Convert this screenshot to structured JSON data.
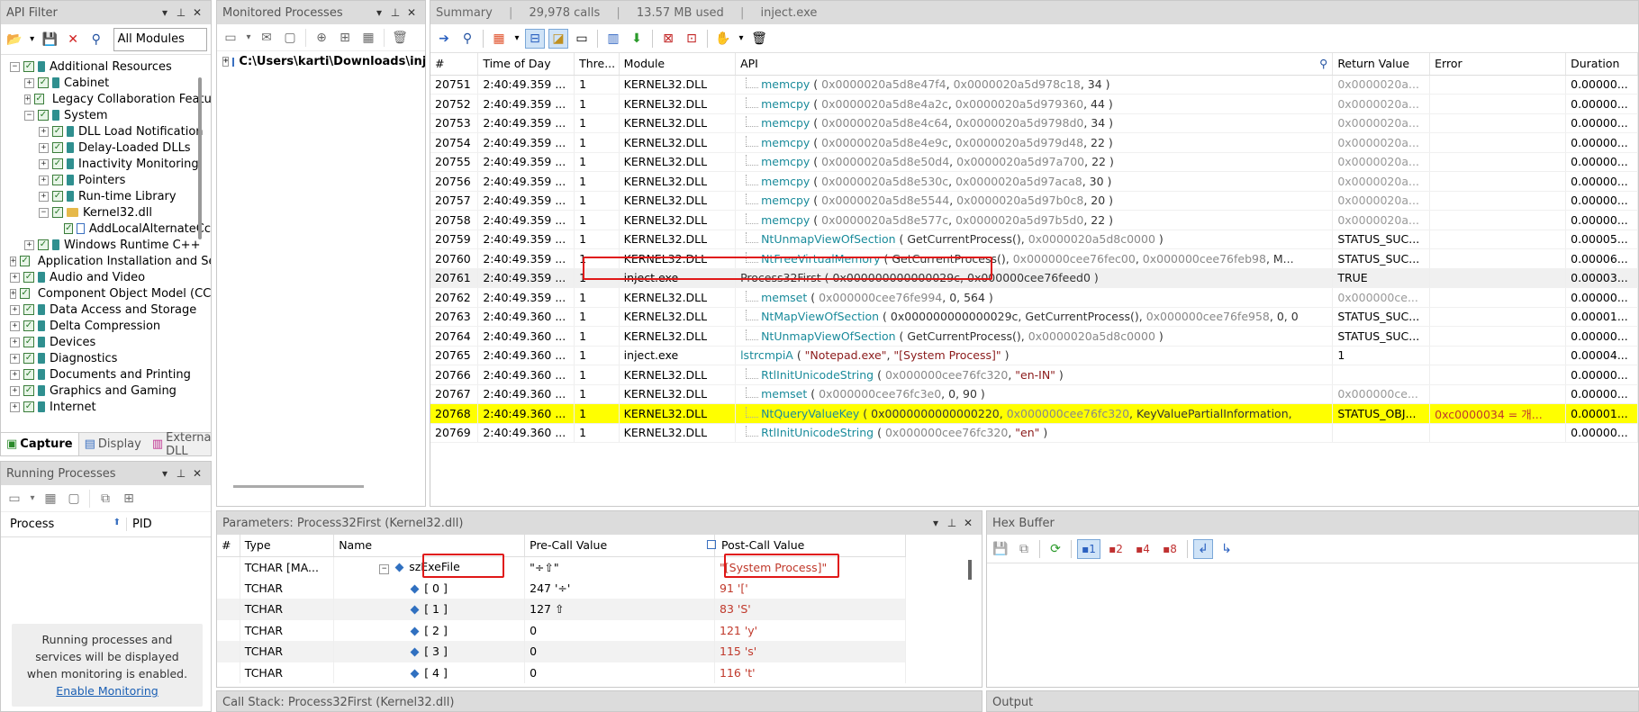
{
  "api_filter": {
    "title": "API Filter",
    "module_select": "All Modules",
    "tree": [
      {
        "label": "Additional Resources",
        "level": 0,
        "exp": "−",
        "icon": "book"
      },
      {
        "label": "Cabinet",
        "level": 1,
        "exp": "+",
        "icon": "book"
      },
      {
        "label": "Legacy Collaboration Featu",
        "level": 1,
        "exp": "+",
        "icon": "book"
      },
      {
        "label": "System",
        "level": 1,
        "exp": "−",
        "icon": "book"
      },
      {
        "label": "DLL Load Notification",
        "level": 2,
        "exp": "+",
        "icon": "book"
      },
      {
        "label": "Delay-Loaded DLLs",
        "level": 2,
        "exp": "+",
        "icon": "book"
      },
      {
        "label": "Inactivity Monitoring",
        "level": 2,
        "exp": "+",
        "icon": "book"
      },
      {
        "label": "Pointers",
        "level": 2,
        "exp": "+",
        "icon": "book"
      },
      {
        "label": "Run-time Library",
        "level": 2,
        "exp": "+",
        "icon": "book"
      },
      {
        "label": "Kernel32.dll",
        "level": 2,
        "exp": "−",
        "icon": "folder"
      },
      {
        "label": "AddLocalAlternateCc",
        "level": 3,
        "exp": "",
        "icon": "item"
      },
      {
        "label": "Windows Runtime C++",
        "level": 1,
        "exp": "+",
        "icon": "book"
      },
      {
        "label": "Application Installation and Se",
        "level": 0,
        "exp": "+",
        "icon": "book"
      },
      {
        "label": "Audio and Video",
        "level": 0,
        "exp": "+",
        "icon": "book"
      },
      {
        "label": "Component Object Model (CC",
        "level": 0,
        "exp": "+",
        "icon": "book"
      },
      {
        "label": "Data Access and Storage",
        "level": 0,
        "exp": "+",
        "icon": "book"
      },
      {
        "label": "Delta Compression",
        "level": 0,
        "exp": "+",
        "icon": "book"
      },
      {
        "label": "Devices",
        "level": 0,
        "exp": "+",
        "icon": "book"
      },
      {
        "label": "Diagnostics",
        "level": 0,
        "exp": "+",
        "icon": "book"
      },
      {
        "label": "Documents and Printing",
        "level": 0,
        "exp": "+",
        "icon": "book"
      },
      {
        "label": "Graphics and Gaming",
        "level": 0,
        "exp": "+",
        "icon": "book"
      },
      {
        "label": "Internet",
        "level": 0,
        "exp": "+",
        "icon": "book"
      }
    ],
    "tabs": [
      "Capture",
      "Display",
      "External DLL"
    ]
  },
  "running_processes": {
    "title": "Running Processes",
    "col_process": "Process",
    "col_pid": "PID",
    "message": "Running processes and services will be displayed when monitoring is enabled.",
    "link": "Enable Monitoring"
  },
  "monitored": {
    "title": "Monitored Processes",
    "path": "C:\\Users\\karti\\Downloads\\inject.e"
  },
  "summary": {
    "title": "Summary",
    "calls": "29,978 calls",
    "mem": "13.57 MB used",
    "exe": "inject.exe",
    "columns": [
      "#",
      "Time of Day",
      "Thre...",
      "Module",
      "API",
      "Return Value",
      "Error",
      "Duration"
    ],
    "rows": [
      {
        "n": "20751",
        "t": "2:40:49.359 ...",
        "th": "1",
        "mod": "KERNEL32.DLL",
        "api": [
          [
            "fn",
            "memcpy"
          ],
          [
            "p",
            " ( "
          ],
          [
            "a",
            "0x0000020a5d8e47f4"
          ],
          [
            "p",
            ", "
          ],
          [
            "a",
            "0x0000020a5d978c18"
          ],
          [
            "p",
            ", 34 )"
          ]
        ],
        "ret": "0x0000020a...",
        "err": "",
        "dur": "0.00000...",
        "ind": true
      },
      {
        "n": "20752",
        "t": "2:40:49.359 ...",
        "th": "1",
        "mod": "KERNEL32.DLL",
        "api": [
          [
            "fn",
            "memcpy"
          ],
          [
            "p",
            " ( "
          ],
          [
            "a",
            "0x0000020a5d8e4a2c"
          ],
          [
            "p",
            ", "
          ],
          [
            "a",
            "0x0000020a5d979360"
          ],
          [
            "p",
            ", 44 )"
          ]
        ],
        "ret": "0x0000020a...",
        "err": "",
        "dur": "0.00000...",
        "ind": true
      },
      {
        "n": "20753",
        "t": "2:40:49.359 ...",
        "th": "1",
        "mod": "KERNEL32.DLL",
        "api": [
          [
            "fn",
            "memcpy"
          ],
          [
            "p",
            " ( "
          ],
          [
            "a",
            "0x0000020a5d8e4c64"
          ],
          [
            "p",
            ", "
          ],
          [
            "a",
            "0x0000020a5d9798d0"
          ],
          [
            "p",
            ", 34 )"
          ]
        ],
        "ret": "0x0000020a...",
        "err": "",
        "dur": "0.00000...",
        "ind": true
      },
      {
        "n": "20754",
        "t": "2:40:49.359 ...",
        "th": "1",
        "mod": "KERNEL32.DLL",
        "api": [
          [
            "fn",
            "memcpy"
          ],
          [
            "p",
            " ( "
          ],
          [
            "a",
            "0x0000020a5d8e4e9c"
          ],
          [
            "p",
            ", "
          ],
          [
            "a",
            "0x0000020a5d979d48"
          ],
          [
            "p",
            ", 22 )"
          ]
        ],
        "ret": "0x0000020a...",
        "err": "",
        "dur": "0.00000...",
        "ind": true
      },
      {
        "n": "20755",
        "t": "2:40:49.359 ...",
        "th": "1",
        "mod": "KERNEL32.DLL",
        "api": [
          [
            "fn",
            "memcpy"
          ],
          [
            "p",
            " ( "
          ],
          [
            "a",
            "0x0000020a5d8e50d4"
          ],
          [
            "p",
            ", "
          ],
          [
            "a",
            "0x0000020a5d97a700"
          ],
          [
            "p",
            ", 22 )"
          ]
        ],
        "ret": "0x0000020a...",
        "err": "",
        "dur": "0.00000...",
        "ind": true
      },
      {
        "n": "20756",
        "t": "2:40:49.359 ...",
        "th": "1",
        "mod": "KERNEL32.DLL",
        "api": [
          [
            "fn",
            "memcpy"
          ],
          [
            "p",
            " ( "
          ],
          [
            "a",
            "0x0000020a5d8e530c"
          ],
          [
            "p",
            ", "
          ],
          [
            "a",
            "0x0000020a5d97aca8"
          ],
          [
            "p",
            ", 30 )"
          ]
        ],
        "ret": "0x0000020a...",
        "err": "",
        "dur": "0.00000...",
        "ind": true
      },
      {
        "n": "20757",
        "t": "2:40:49.359 ...",
        "th": "1",
        "mod": "KERNEL32.DLL",
        "api": [
          [
            "fn",
            "memcpy"
          ],
          [
            "p",
            " ( "
          ],
          [
            "a",
            "0x0000020a5d8e5544"
          ],
          [
            "p",
            ", "
          ],
          [
            "a",
            "0x0000020a5d97b0c8"
          ],
          [
            "p",
            ", 20 )"
          ]
        ],
        "ret": "0x0000020a...",
        "err": "",
        "dur": "0.00000...",
        "ind": true
      },
      {
        "n": "20758",
        "t": "2:40:49.359 ...",
        "th": "1",
        "mod": "KERNEL32.DLL",
        "api": [
          [
            "fn",
            "memcpy"
          ],
          [
            "p",
            " ( "
          ],
          [
            "a",
            "0x0000020a5d8e577c"
          ],
          [
            "p",
            ", "
          ],
          [
            "a",
            "0x0000020a5d97b5d0"
          ],
          [
            "p",
            ", 22 )"
          ]
        ],
        "ret": "0x0000020a...",
        "err": "",
        "dur": "0.00000...",
        "ind": true
      },
      {
        "n": "20759",
        "t": "2:40:49.359 ...",
        "th": "1",
        "mod": "KERNEL32.DLL",
        "api": [
          [
            "fn",
            "NtUnmapViewOfSection"
          ],
          [
            "p",
            " ( GetCurrentProcess(), "
          ],
          [
            "a",
            "0x0000020a5d8c0000"
          ],
          [
            "p",
            " )"
          ]
        ],
        "ret": "STATUS_SUC...",
        "err": "",
        "dur": "0.00005...",
        "ind": true
      },
      {
        "n": "20760",
        "t": "2:40:49.359 ...",
        "th": "1",
        "mod": "KERNEL32.DLL",
        "api": [
          [
            "fn",
            "NtFreeVirtualMemory"
          ],
          [
            "p",
            " ( GetCurrentProcess(), "
          ],
          [
            "a",
            "0x000000cee76fec00"
          ],
          [
            "p",
            ", "
          ],
          [
            "a",
            "0x000000cee76feb98"
          ],
          [
            "p",
            ", M..."
          ]
        ],
        "ret": "STATUS_SUC...",
        "err": "",
        "dur": "0.00006...",
        "ind": true
      },
      {
        "n": "20761",
        "t": "2:40:49.359 ...",
        "th": "1",
        "mod": "inject.exe",
        "api": [
          [
            "p",
            "Process32First ( 0x000000000000029c, 0x000000cee76feed0 )"
          ]
        ],
        "ret": "TRUE",
        "err": "",
        "dur": "0.00003...",
        "ind": false,
        "sel": true
      },
      {
        "n": "20762",
        "t": "2:40:49.359 ...",
        "th": "1",
        "mod": "KERNEL32.DLL",
        "api": [
          [
            "fn",
            "memset"
          ],
          [
            "p",
            " ( "
          ],
          [
            "a",
            "0x000000cee76fe994"
          ],
          [
            "p",
            ", 0, 564 )"
          ]
        ],
        "ret": "0x000000ce...",
        "err": "",
        "dur": "0.00000...",
        "ind": true
      },
      {
        "n": "20763",
        "t": "2:40:49.360 ...",
        "th": "1",
        "mod": "KERNEL32.DLL",
        "api": [
          [
            "fn",
            "NtMapViewOfSection"
          ],
          [
            "p",
            " ( 0x000000000000029c, GetCurrentProcess(), "
          ],
          [
            "a",
            "0x000000cee76fe958"
          ],
          [
            "p",
            ", 0, 0"
          ]
        ],
        "ret": "STATUS_SUC...",
        "err": "",
        "dur": "0.00001...",
        "ind": true
      },
      {
        "n": "20764",
        "t": "2:40:49.360 ...",
        "th": "1",
        "mod": "KERNEL32.DLL",
        "api": [
          [
            "fn",
            "NtUnmapViewOfSection"
          ],
          [
            "p",
            " ( GetCurrentProcess(), "
          ],
          [
            "a",
            "0x0000020a5d8c0000"
          ],
          [
            "p",
            " )"
          ]
        ],
        "ret": "STATUS_SUC...",
        "err": "",
        "dur": "0.00000...",
        "ind": true
      },
      {
        "n": "20765",
        "t": "2:40:49.360 ...",
        "th": "1",
        "mod": "inject.exe",
        "api": [
          [
            "fn",
            "lstrcmpiA"
          ],
          [
            "p",
            " ( "
          ],
          [
            "s",
            "\"Notepad.exe\""
          ],
          [
            "p",
            ", "
          ],
          [
            "s",
            "\"[System Process]\""
          ],
          [
            "p",
            " )"
          ]
        ],
        "ret": "1",
        "err": "",
        "dur": "0.00004...",
        "ind": false
      },
      {
        "n": "20766",
        "t": "2:40:49.360 ...",
        "th": "1",
        "mod": "KERNEL32.DLL",
        "api": [
          [
            "fn",
            "RtlInitUnicodeString"
          ],
          [
            "p",
            " ( "
          ],
          [
            "a",
            "0x000000cee76fc320"
          ],
          [
            "p",
            ", "
          ],
          [
            "s",
            "\"en-IN\""
          ],
          [
            "p",
            " )"
          ]
        ],
        "ret": "",
        "err": "",
        "dur": "0.00000...",
        "ind": true
      },
      {
        "n": "20767",
        "t": "2:40:49.360 ...",
        "th": "1",
        "mod": "KERNEL32.DLL",
        "api": [
          [
            "fn",
            "memset"
          ],
          [
            "p",
            " ( "
          ],
          [
            "a",
            "0x000000cee76fc3e0"
          ],
          [
            "p",
            ", 0, 90 )"
          ]
        ],
        "ret": "0x000000ce...",
        "err": "",
        "dur": "0.00000...",
        "ind": true
      },
      {
        "n": "20768",
        "t": "2:40:49.360 ...",
        "th": "1",
        "mod": "KERNEL32.DLL",
        "api": [
          [
            "fn",
            "NtQueryValueKey"
          ],
          [
            "p",
            " ( 0x0000000000000220, "
          ],
          [
            "a",
            "0x000000cee76fc320"
          ],
          [
            "p",
            ", KeyValuePartialInformation,"
          ]
        ],
        "ret": "STATUS_OBJ...",
        "err": "0xc0000034 = 개...",
        "dur": "0.00001...",
        "ind": true,
        "hl": true
      },
      {
        "n": "20769",
        "t": "2:40:49.360 ...",
        "th": "1",
        "mod": "KERNEL32.DLL",
        "api": [
          [
            "fn",
            "RtlInitUnicodeString"
          ],
          [
            "p",
            " ( "
          ],
          [
            "a",
            "0x000000cee76fc320"
          ],
          [
            "p",
            ", "
          ],
          [
            "s",
            "\"en\""
          ],
          [
            "p",
            " )"
          ]
        ],
        "ret": "",
        "err": "",
        "dur": "0.00000...",
        "ind": true
      }
    ]
  },
  "params": {
    "title": "Parameters: Process32First (Kernel32.dll)",
    "columns": [
      "#",
      "Type",
      "Name",
      "Pre-Call Value",
      "Post-Call Value"
    ],
    "rows": [
      {
        "type": "TCHAR [MA...",
        "name": "szExeFile",
        "pre": "\"÷⇧\"",
        "post": "\"[System Process]\"",
        "main": true
      },
      {
        "type": "TCHAR",
        "name": "[ 0 ]",
        "pre": "247 '÷'",
        "post": "91 '['"
      },
      {
        "type": "TCHAR",
        "name": "[ 1 ]",
        "pre": "127 ⇧",
        "post": "83 'S'"
      },
      {
        "type": "TCHAR",
        "name": "[ 2 ]",
        "pre": "0",
        "post": "121 'y'"
      },
      {
        "type": "TCHAR",
        "name": "[ 3 ]",
        "pre": "0",
        "post": "115 's'"
      },
      {
        "type": "TCHAR",
        "name": "[ 4 ]",
        "pre": "0",
        "post": "116 't'"
      }
    ]
  },
  "hex": {
    "title": "Hex Buffer",
    "buttons": [
      "1",
      "2",
      "4",
      "8"
    ]
  },
  "callstack": {
    "title": "Call Stack: Process32First (Kernel32.dll)"
  },
  "output": {
    "title": "Output"
  },
  "colors": {
    "highlight": "#ffff00",
    "red_box": "#e01818",
    "function": "#1a8b9b",
    "string": "#8b1a1a"
  }
}
